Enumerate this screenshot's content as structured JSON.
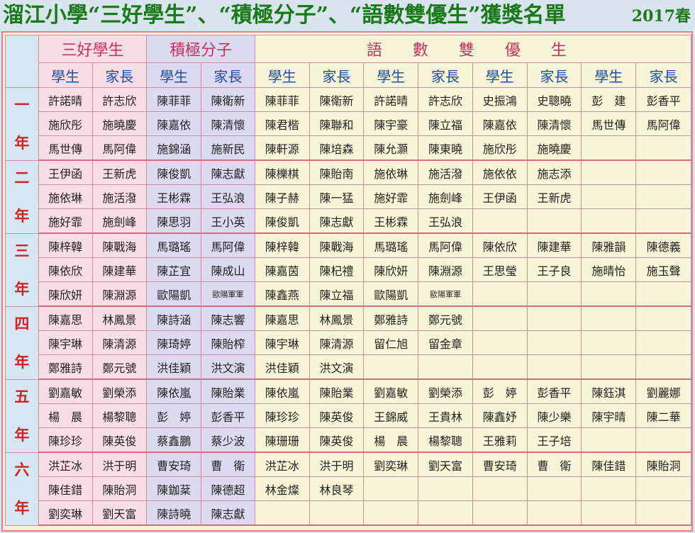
{
  "title": "溜江小學“三好學生”、“積極分子”、“語數雙優生”獲獎名單",
  "year": "2017春",
  "headers": {
    "sanhao": "三好學生",
    "jiji": "積極分子",
    "yushu": "語 數 雙 優 生",
    "student": "學生",
    "parent": "家長"
  },
  "grades": [
    {
      "name": [
        "一",
        "年"
      ],
      "rows": [
        [
          "許諾晴",
          "許志欣",
          "陳菲菲",
          "陳衛新",
          "陳菲菲",
          "陳衛新",
          "許諾晴",
          "許志欣",
          "史振鴻",
          "史聰曉",
          "彭　建",
          "彭香平"
        ],
        [
          "施欣彤",
          "施曉慶",
          "陳嘉依",
          "陳清懷",
          "陳君楷",
          "陳聯和",
          "陳宇豪",
          "陳立福",
          "陳嘉依",
          "陳清懷",
          "馬世傳",
          "馬阿偉"
        ],
        [
          "馬世傳",
          "馬阿偉",
          "施錦涵",
          "施新民",
          "陳軒源",
          "陳培森",
          "陳允灝",
          "陳東曉",
          "施欣彤",
          "施曉慶",
          "",
          ""
        ]
      ]
    },
    {
      "name": [
        "二",
        "年"
      ],
      "rows": [
        [
          "王伊函",
          "王新虎",
          "陳俊凱",
          "陳志獻",
          "陳櫟棋",
          "陳貽南",
          "施依琳",
          "施活潑",
          "施依依",
          "施志添",
          "",
          ""
        ],
        [
          "施依琳",
          "施活潑",
          "王彬霖",
          "王弘浪",
          "陳子赫",
          "陳一猛",
          "施好霏",
          "施劍峰",
          "王伊函",
          "王新虎",
          "",
          ""
        ],
        [
          "施好霏",
          "施劍峰",
          "陳思羽",
          "王小英",
          "陳俊凱",
          "陳志獻",
          "王彬霖",
          "王弘浪",
          "",
          "",
          "",
          ""
        ]
      ]
    },
    {
      "name": [
        "三",
        "年"
      ],
      "rows": [
        [
          "陳梓韓",
          "陳戰海",
          "馬璐瑤",
          "馬阿偉",
          "陳梓韓",
          "陳戰海",
          "馬璐瑤",
          "馬阿偉",
          "陳依欣",
          "陳建華",
          "陳雅韻",
          "陳德義"
        ],
        [
          "陳依欣",
          "陳建華",
          "陳芷宜",
          "陳成山",
          "陳嘉茵",
          "陳杞禮",
          "陳欣妍",
          "陳淵源",
          "王思瑩",
          "王子良",
          "施晴怡",
          "施玉聲"
        ],
        [
          "陳欣妍",
          "陳淵源",
          "歐陽凱",
          "歐陽軍軍",
          "陳鑫燕",
          "陳立福",
          "歐陽凱",
          "歐陽軍軍",
          "",
          "",
          "",
          ""
        ]
      ]
    },
    {
      "name": [
        "四",
        "年"
      ],
      "rows": [
        [
          "陳嘉思",
          "林鳳景",
          "陳詩涵",
          "陳志響",
          "陳嘉思",
          "林鳳景",
          "鄭雅詩",
          "鄭元號",
          "",
          "",
          "",
          ""
        ],
        [
          "陳宇琳",
          "陳清源",
          "陳琦婷",
          "陳貽榨",
          "陳宇琳",
          "陳清源",
          "留仁旭",
          "留金章",
          "",
          "",
          "",
          ""
        ],
        [
          "鄭雅詩",
          "鄭元號",
          "洪佳穎",
          "洪文演",
          "洪佳穎",
          "洪文演",
          "",
          "",
          "",
          "",
          "",
          ""
        ]
      ]
    },
    {
      "name": [
        "五",
        "年"
      ],
      "rows": [
        [
          "劉嘉敏",
          "劉榮添",
          "陳依嵐",
          "陳貽業",
          "陳依嵐",
          "陳貽業",
          "劉嘉敏",
          "劉榮添",
          "彭　婷",
          "彭香平",
          "陳鈺淇",
          "劉麗娜"
        ],
        [
          "楊　晨",
          "楊黎聰",
          "彭　婷",
          "彭香平",
          "陳珍珍",
          "陳英俊",
          "王錦威",
          "王貴林",
          "陳鑫妤",
          "陳少樂",
          "陳宇晴",
          "陳二華"
        ],
        [
          "陳珍珍",
          "陳英俊",
          "蔡鑫鵬",
          "蔡少波",
          "陳珊珊",
          "陳英俊",
          "楊　晨",
          "楊黎聰",
          "王雅莉",
          "王子培",
          "",
          ""
        ]
      ]
    },
    {
      "name": [
        "六",
        "年"
      ],
      "rows": [
        [
          "洪芷冰",
          "洪于明",
          "曹安琦",
          "曹　衛",
          "洪芷冰",
          "洪于明",
          "劉奕琳",
          "劉天富",
          "曹安琦",
          "曹　衛",
          "陳佳錯",
          "陳貽洞"
        ],
        [
          "陳佳錯",
          "陳貽洞",
          "陳鉫棻",
          "陳德超",
          "林金燦",
          "林良琴",
          "",
          "",
          "",
          "",
          "",
          ""
        ],
        [
          "劉奕琳",
          "劉天富",
          "陳詩曉",
          "陳志獻",
          "",
          "",
          "",
          "",
          "",
          "",
          "",
          ""
        ]
      ]
    }
  ]
}
